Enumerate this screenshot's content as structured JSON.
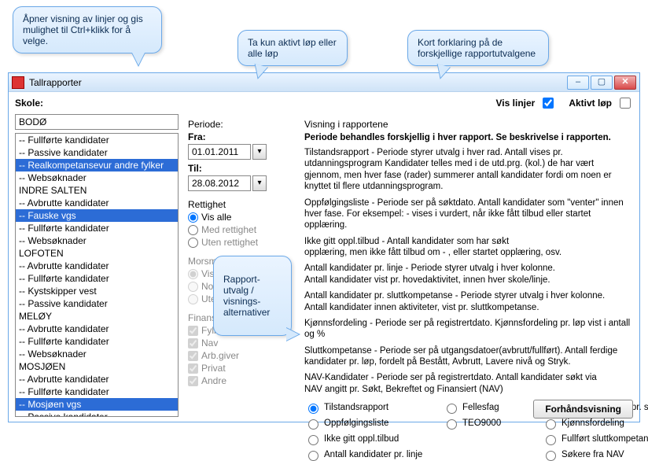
{
  "callouts": {
    "left": "Åpner visning av linjer og gis mulighet til Ctrl+klikk for å velge.",
    "mid": "Ta kun aktivt løp eller alle løp",
    "right": "Kort forklaring på de forskjellige rapportutvalgene",
    "center": "Rapport-\nutvalg /\nvisnings-\nalternativer"
  },
  "window": {
    "title": "Tallrapporter"
  },
  "toprow": {
    "skole_label": "Skole:",
    "skole_value": "BODØ",
    "vis_linjer_label": "Vis linjer",
    "vis_linjer_checked": true,
    "aktivt_lop_label": "Aktivt løp",
    "aktivt_lop_checked": false
  },
  "tree": [
    {
      "t": "-- Fullførte kandidater",
      "sel": false
    },
    {
      "t": "-- Passive kandidater",
      "sel": false
    },
    {
      "t": "-- Realkompetansevur andre fylker",
      "sel": true
    },
    {
      "t": "-- Websøknader",
      "sel": false
    },
    {
      "t": "INDRE SALTEN",
      "sel": false
    },
    {
      "t": "-- Avbrutte kandidater",
      "sel": false
    },
    {
      "t": "-- Fauske vgs",
      "sel": true
    },
    {
      "t": "-- Fullførte kandidater",
      "sel": false
    },
    {
      "t": "-- Websøknader",
      "sel": false
    },
    {
      "t": "LOFOTEN",
      "sel": false
    },
    {
      "t": "-- Avbrutte kandidater",
      "sel": false
    },
    {
      "t": "-- Fullførte kandidater",
      "sel": false
    },
    {
      "t": "-- Kystskipper vest",
      "sel": false
    },
    {
      "t": "-- Passive kandidater",
      "sel": false
    },
    {
      "t": "MELØY",
      "sel": false
    },
    {
      "t": "-- Avbrutte kandidater",
      "sel": false
    },
    {
      "t": "-- Fullførte kandidater",
      "sel": false
    },
    {
      "t": "-- Websøknader",
      "sel": false
    },
    {
      "t": "MOSJØEN",
      "sel": false
    },
    {
      "t": "-- Avbrutte kandidater",
      "sel": false
    },
    {
      "t": "-- Fullførte kandidater",
      "sel": false
    },
    {
      "t": "-- Mosjøen vgs",
      "sel": true
    },
    {
      "t": "-- Passive kandidater",
      "sel": false
    }
  ],
  "periode": {
    "heading": "Periode:",
    "fra_label": "Fra:",
    "fra_value": "01.01.2011",
    "til_label": "Til:",
    "til_value": "28.08.2012"
  },
  "rettighet": {
    "heading": "Rettighet",
    "opts": [
      "Vis alle",
      "Med rettighet",
      "Uten rettighet"
    ],
    "selected": 0,
    "muted": [
      false,
      true,
      true
    ]
  },
  "morsmal": {
    "heading": "Morsmål",
    "opts": [
      "Vis alle",
      "Norsk",
      "Utenlandsk"
    ],
    "selected": 0,
    "muted": [
      true,
      true,
      true
    ]
  },
  "finans": {
    "heading": "Finansiering",
    "opts": [
      "Fylket",
      "Nav",
      "Arb.giver",
      "Privat",
      "Andre"
    ]
  },
  "report": {
    "heading": "Visning i rapportene",
    "lead": "Periode behandles forskjellig i hver rapport. Se beskrivelse i rapporten.",
    "paras": [
      "Tilstandsrapport - Periode styrer utvalg i hver rad. Antall vises pr. utdanningsprogram Kandidater telles med i de utd.prg. (kol.) de har vært gjennom, men hver fase (rader) summerer antall kandidater fordi om noen er knyttet til flere utdanningsprogram.",
      "Oppfølgingsliste - Periode ser på søktdato. Antall kandidater som \"venter\" innen hver fase. For eksempel: - vises i vurdert, når ikke fått tilbud eller startet opplæring.",
      "Ikke gitt oppl.tilbud - Antall kandidater som har søkt\nopplæring, men ikke fått tilbud om - , eller startet opplæring, osv.",
      "Antall kandidater pr. linje - Periode styrer utvalg i hver kolonne.\nAntall kandidater vist pr. hovedaktivitet, innen hver skole/linje.",
      "Antall kandidater pr. sluttkompetanse - Periode styrer utvalg i hver kolonne.\nAntall kandidater innen aktiviteter, vist pr. sluttkompetanse.",
      "Kjønnsfordeling - Periode ser på registrertdato. Kjønnsfordeling pr. løp vist i antall og %",
      "Sluttkompetanse - Periode ser på utgangsdatoer(avbrutt/fullført). Antall ferdige kandidater pr. løp, fordelt på Bestått, Avbrutt, Lavere nivå og Stryk.",
      "NAV-Kandidater - Periode ser på registrertdato. Antall kandidater søkt via\nNAV angitt pr. Søkt, Bekreftet og Finansiert (NAV)"
    ],
    "choices": [
      [
        "Tilstandsrapport",
        "Fellesfag",
        "Antall kandidater pr. sluttkompetanse"
      ],
      [
        "Oppfølgingsliste",
        "TEO9000",
        "Kjønnsfordeling"
      ],
      [
        "Ikke gitt oppl.tilbud",
        "",
        "Fullført sluttkompetanse"
      ],
      [
        "Antall kandidater pr. linje",
        "",
        "Søkere fra NAV"
      ]
    ],
    "selected": "Tilstandsrapport",
    "preview_label": "Forhåndsvisning"
  }
}
